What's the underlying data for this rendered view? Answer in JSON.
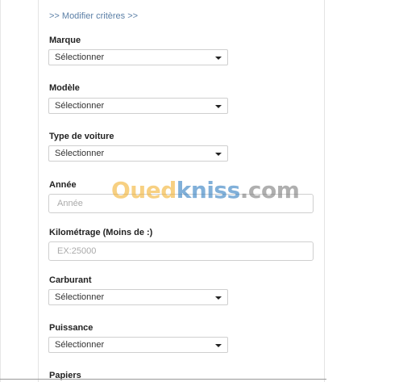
{
  "criteria_link": ">> Modifier critères >>",
  "form": {
    "marque": {
      "label": "Marque",
      "value": "Sélectionner"
    },
    "modele": {
      "label": "Modèle",
      "value": "Sélectionner"
    },
    "type_voiture": {
      "label": "Type de voiture",
      "value": "Sélectionner"
    },
    "annee": {
      "label": "Année",
      "placeholder": "Année",
      "value": ""
    },
    "kilometrage": {
      "label": "Kilométrage (Moins de :)",
      "placeholder": "EX:25000",
      "value": ""
    },
    "carburant": {
      "label": "Carburant",
      "value": "Sélectionner"
    },
    "puissance": {
      "label": "Puissance",
      "value": "Sélectionner"
    },
    "papiers": {
      "label": "Papiers"
    }
  },
  "watermark": {
    "part1": "Oued",
    "part2": "kniss",
    "part3": ".com"
  },
  "colors": {
    "link": "#5b7fa6",
    "watermark_orange": "#f2b230",
    "watermark_blue": "#2e7cc0"
  }
}
